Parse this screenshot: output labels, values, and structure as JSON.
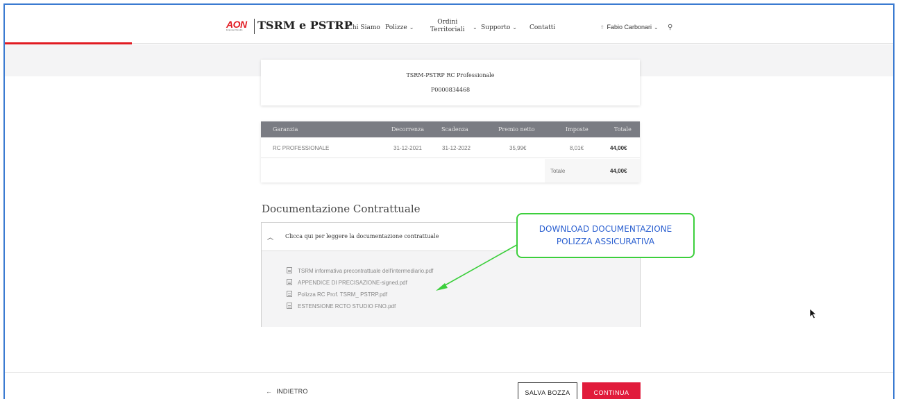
{
  "header": {
    "logo_text": "AON",
    "logo_sub": "Empower Results",
    "brand": "TSRM e PSTRP",
    "nav": [
      {
        "label": "Chi Siamo"
      },
      {
        "label": "Polizze"
      },
      {
        "label_line1": "Ordini",
        "label_line2": "Territoriali"
      },
      {
        "label": "Supporto"
      },
      {
        "label": "Contatti"
      }
    ],
    "user_name": "Fabio Carbonari"
  },
  "policy": {
    "product": "TSRM-PSTRP RC Professionale",
    "number": "P0000834468"
  },
  "table": {
    "headers": [
      "Garanzia",
      "Decorrenza",
      "Scadenza",
      "Premio netto",
      "Imposte",
      "Totale"
    ],
    "rows": [
      {
        "garanzia": "RC PROFESSIONALE",
        "decorrenza": "31-12-2021",
        "scadenza": "31-12-2022",
        "premio": "35,99€",
        "imposte": "8,01€",
        "totale": "44,00€"
      }
    ],
    "total_label": "Totale",
    "total_value": "44,00€"
  },
  "docs": {
    "title": "Documentazione Contrattuale",
    "accordion_label": "Clicca qui per leggere la documentazione contrattuale",
    "files": [
      "TSRM informativa precontrattuale dell'intermediario.pdf",
      "APPENDICE DI PRECISAZIONE-signed.pdf",
      "Polizza RC Prof. TSRM_ PSTRP.pdf",
      "ESTENSIONE RCTO STUDIO FNO.pdf"
    ]
  },
  "annotation": {
    "line1": "DOWNLOAD DOCUMENTAZIONE",
    "line2": "POLIZZA ASSICURATIVA",
    "border_color": "#3ccf3c",
    "text_color": "#2a5fd0"
  },
  "footer": {
    "back_label": "INDIETRO",
    "draft_label": "SALVA BOZZA",
    "continue_label": "CONTINUA"
  },
  "colors": {
    "accent": "#e11b22",
    "table_header": "#7a7c83",
    "continue_button": "#e11b3b"
  }
}
